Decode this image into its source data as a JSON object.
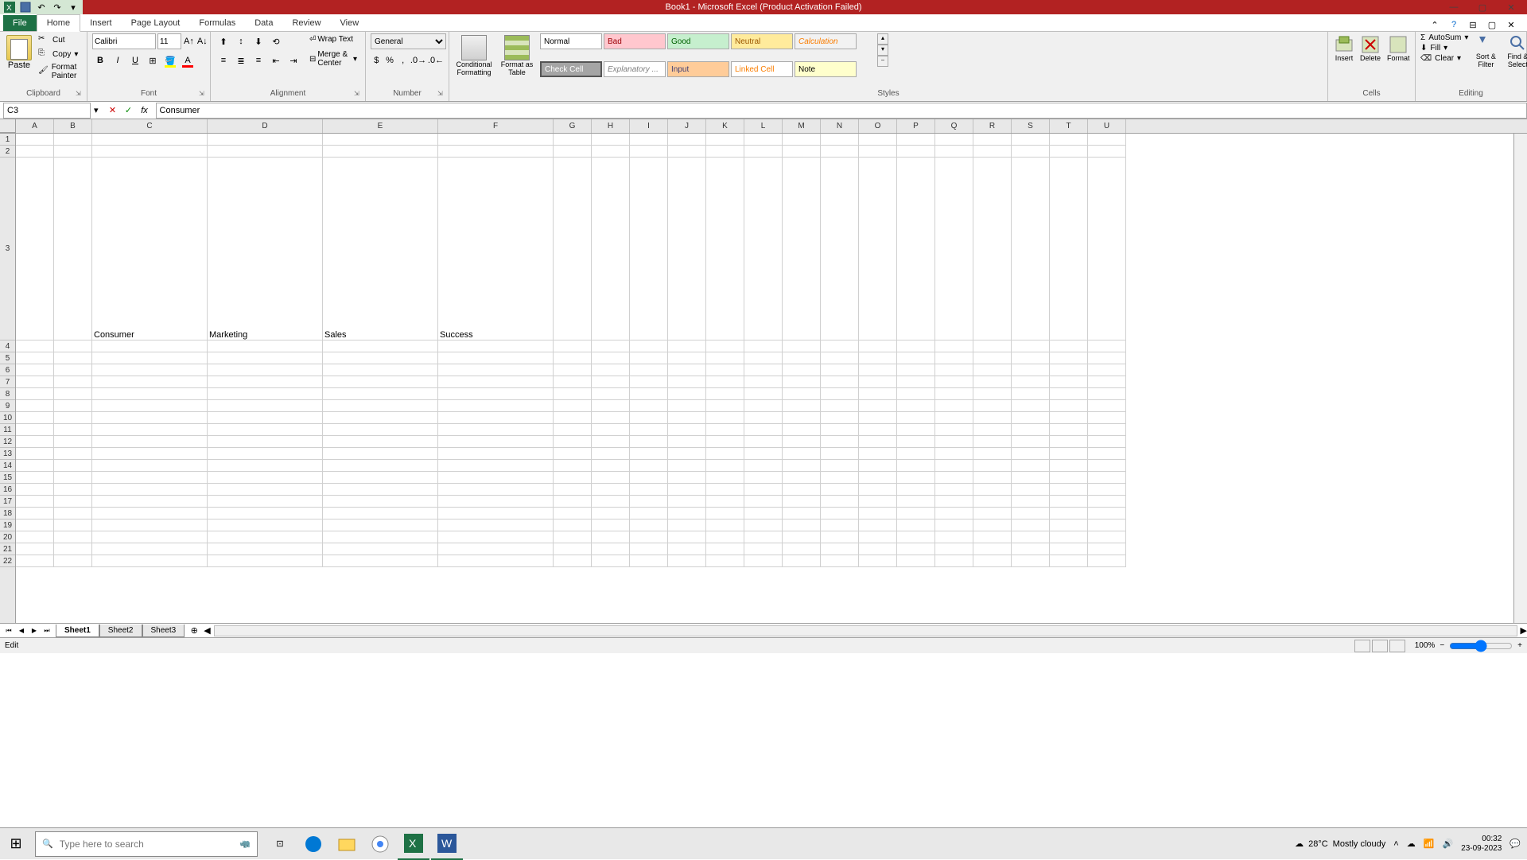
{
  "title": "Book1 - Microsoft Excel (Product Activation Failed)",
  "tabs": {
    "file": "File",
    "home": "Home",
    "insert": "Insert",
    "page_layout": "Page Layout",
    "formulas": "Formulas",
    "data": "Data",
    "review": "Review",
    "view": "View"
  },
  "clipboard": {
    "paste": "Paste",
    "cut": "Cut",
    "copy": "Copy",
    "format_painter": "Format Painter",
    "label": "Clipboard"
  },
  "font": {
    "name": "Calibri",
    "size": "11",
    "label": "Font"
  },
  "alignment": {
    "wrap": "Wrap Text",
    "merge": "Merge & Center",
    "label": "Alignment"
  },
  "number": {
    "format": "General",
    "label": "Number"
  },
  "styles": {
    "cond": "Conditional Formatting",
    "table": "Format as Table",
    "normal": "Normal",
    "bad": "Bad",
    "good": "Good",
    "neutral": "Neutral",
    "calc": "Calculation",
    "check": "Check Cell",
    "explan": "Explanatory ...",
    "input": "Input",
    "linked": "Linked Cell",
    "note": "Note",
    "label": "Styles"
  },
  "cells": {
    "insert": "Insert",
    "delete": "Delete",
    "format": "Format",
    "label": "Cells"
  },
  "editing": {
    "autosum": "AutoSum",
    "fill": "Fill",
    "clear": "Clear",
    "sort": "Sort & Filter",
    "find": "Find & Select",
    "label": "Editing"
  },
  "name_box": "C3",
  "formula_value": "Consumer",
  "columns": [
    "A",
    "B",
    "C",
    "D",
    "E",
    "F",
    "G",
    "H",
    "I",
    "J",
    "K",
    "L",
    "M",
    "N",
    "O",
    "P",
    "Q",
    "R",
    "S",
    "T",
    "U"
  ],
  "row_count": 22,
  "data_cells": {
    "C3": "Consumer",
    "D3": "Marketing",
    "E3": "Sales",
    "F3": "Success"
  },
  "sheets": {
    "s1": "Sheet1",
    "s2": "Sheet2",
    "s3": "Sheet3"
  },
  "status": "Edit",
  "zoom": "100%",
  "search_placeholder": "Type here to search",
  "weather": {
    "temp": "28°C",
    "cond": "Mostly cloudy"
  },
  "clock": {
    "time": "00:32",
    "date": "23-09-2023"
  }
}
